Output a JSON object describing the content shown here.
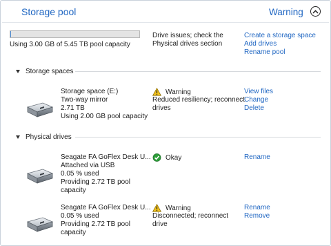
{
  "header": {
    "title": "Storage pool",
    "status": "Warning"
  },
  "pool": {
    "capacity_text": "Using 3.00 GB of 5.45 TB pool capacity",
    "capacity_used_fraction": 0.0005,
    "summary_line1": "Drive issues; check the",
    "summary_line2": "Physical drives section",
    "links": [
      "Create a storage space",
      "Add drives",
      "Rename pool"
    ]
  },
  "sections": {
    "storage_spaces": "Storage spaces",
    "physical_drives": "Physical drives"
  },
  "storage_space": {
    "name": "Storage space (E:)",
    "type": "Two-way mirror",
    "size": "2.71 TB",
    "usage": "Using 2.00 GB pool capacity",
    "status": "Warning",
    "status_detail_line1": "Reduced resiliency; reconnect",
    "status_detail_line2": "drives",
    "links": [
      "View files",
      "Change",
      "Delete"
    ]
  },
  "drives": [
    {
      "name": "Seagate FA GoFlex Desk U...",
      "line2": "Attached via USB",
      "line3": "0.05 % used",
      "line4": "Providing 2.72 TB pool",
      "line5": "capacity",
      "status": "Okay",
      "links": [
        "Rename"
      ]
    },
    {
      "name": "Seagate FA GoFlex Desk U...",
      "line2": "0.05 % used",
      "line3": "Providing 2.72 TB pool",
      "line4": "capacity",
      "status": "Warning",
      "status_detail_line1": "Disconnected; reconnect",
      "status_detail_line2": "drive",
      "links": [
        "Rename",
        "Remove"
      ]
    }
  ],
  "colors": {
    "accent": "#1f66c2",
    "warning": "#f2c21a",
    "ok": "#2e9e3a"
  },
  "icons": {
    "collapse": "chevron-up-icon",
    "drive": "hard-drive-icon",
    "warning": "warning-icon",
    "ok": "checkmark-icon"
  }
}
